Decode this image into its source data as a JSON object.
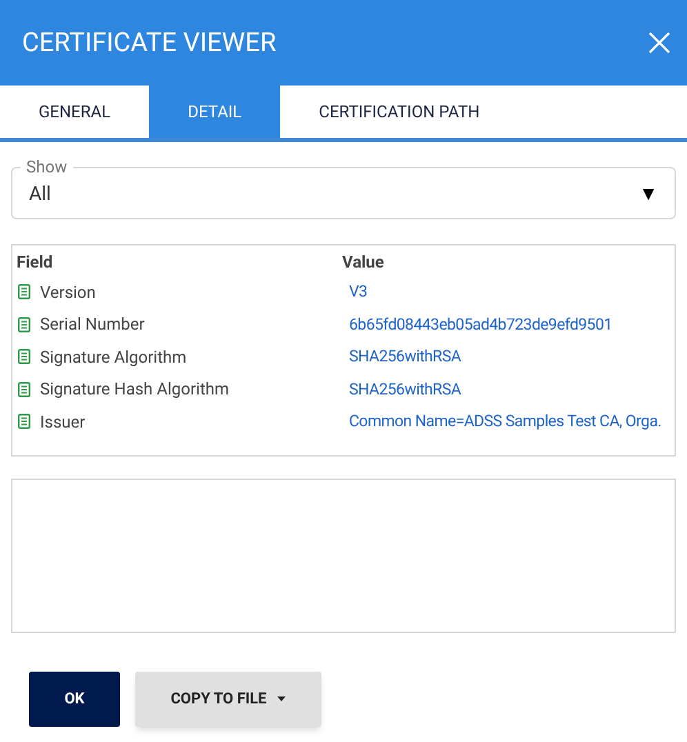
{
  "window": {
    "title": "CERTIFICATE VIEWER"
  },
  "tabs": [
    {
      "label": "GENERAL",
      "selected": false
    },
    {
      "label": "DETAIL",
      "selected": true
    },
    {
      "label": "CERTIFICATION PATH",
      "selected": false
    }
  ],
  "show": {
    "label": "Show",
    "value": "All",
    "arrow": "▼"
  },
  "table": {
    "columns": [
      "Field",
      "Value"
    ],
    "rows": [
      {
        "field": "Version",
        "value": "V3"
      },
      {
        "field": "Serial Number",
        "value": "6b65fd08443eb05ad4b723de9efd9501"
      },
      {
        "field": "Signature Algorithm",
        "value": "SHA256withRSA"
      },
      {
        "field": "Signature Hash Algorithm",
        "value": "SHA256withRSA"
      },
      {
        "field": "Issuer",
        "value": "Common Name=ADSS Samples Test CA, Orga."
      }
    ]
  },
  "buttons": [
    {
      "label": "OK",
      "kind": "primary"
    },
    {
      "label": "COPY TO FILE",
      "kind": "menu"
    }
  ]
}
